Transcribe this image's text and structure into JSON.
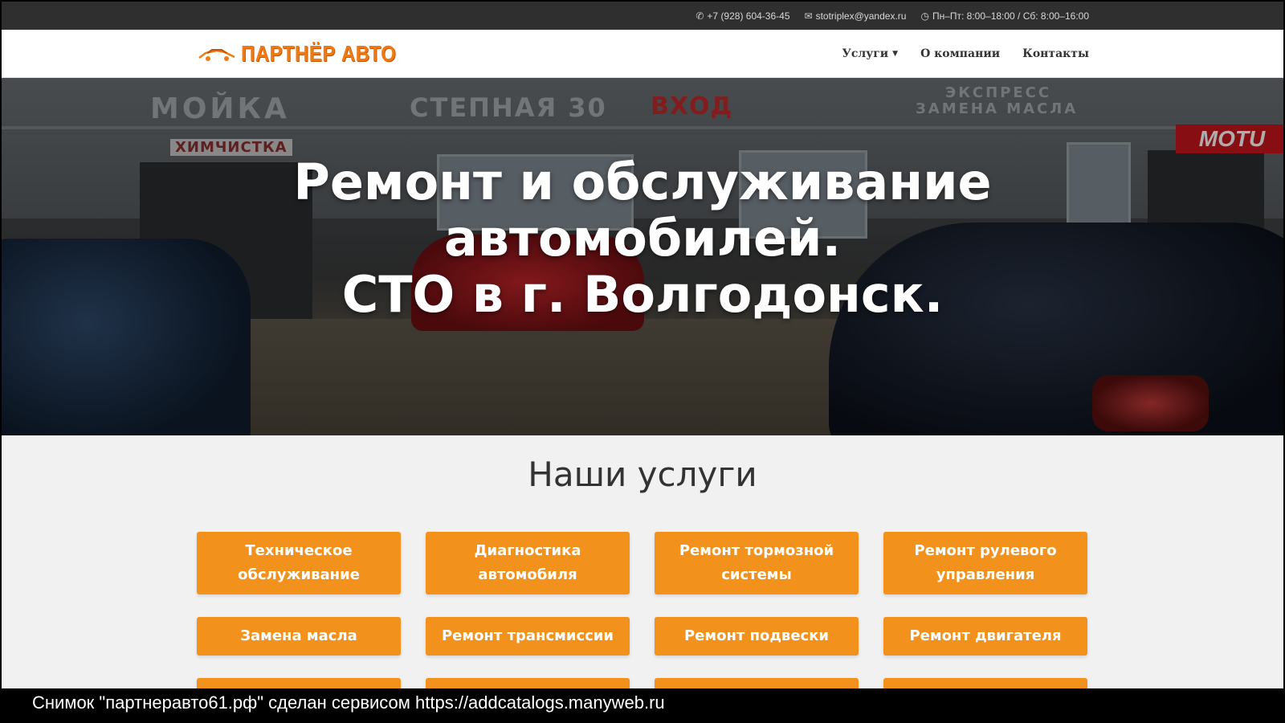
{
  "topbar": {
    "phone": "+7 (928) 604-36-45",
    "email": "stotriplex@yandex.ru",
    "hours": "Пн–Пт: 8:00–18:00 / Сб: 8:00–16:00"
  },
  "header": {
    "logo_text": "ПАРТНЁР АВТО",
    "nav": [
      {
        "label": "Услуги"
      },
      {
        "label": "О компании"
      },
      {
        "label": "Контакты"
      }
    ]
  },
  "hero": {
    "line1": "Ремонт и обслуживание",
    "line2": "автомобилей.",
    "line3": "СТО в г. Волгодонск.",
    "photo_signs": {
      "sign1": "МОЙКА",
      "sign2": "СТЕПНАЯ 30",
      "sign3": "ВХОД",
      "sign4": "ХИМЧИСТКА",
      "sign5": "ЭКСПРЕСС",
      "sign6": "ЗАМЕНА МАСЛА",
      "sign7": "MOTU"
    }
  },
  "services": {
    "title": "Наши услуги",
    "items": [
      {
        "label_l1": "Техническое",
        "label_l2": "обслуживание"
      },
      {
        "label_l1": "Диагностика",
        "label_l2": "автомобиля"
      },
      {
        "label_l1": "Ремонт тормозной",
        "label_l2": "системы"
      },
      {
        "label_l1": "Ремонт рулевого",
        "label_l2": "управления"
      },
      {
        "label_l1": "Замена масла"
      },
      {
        "label_l1": "Ремонт трансмиссии"
      },
      {
        "label_l1": "Ремонт подвески"
      },
      {
        "label_l1": "Ремонт двигателя"
      }
    ]
  },
  "caption": "Снимок \"партнеравто61.рф\" сделан сервисом https://addcatalogs.manyweb.ru",
  "colors": {
    "accent": "#f2911b",
    "logo": "#f07a12",
    "topbar": "#2f2f2f"
  }
}
